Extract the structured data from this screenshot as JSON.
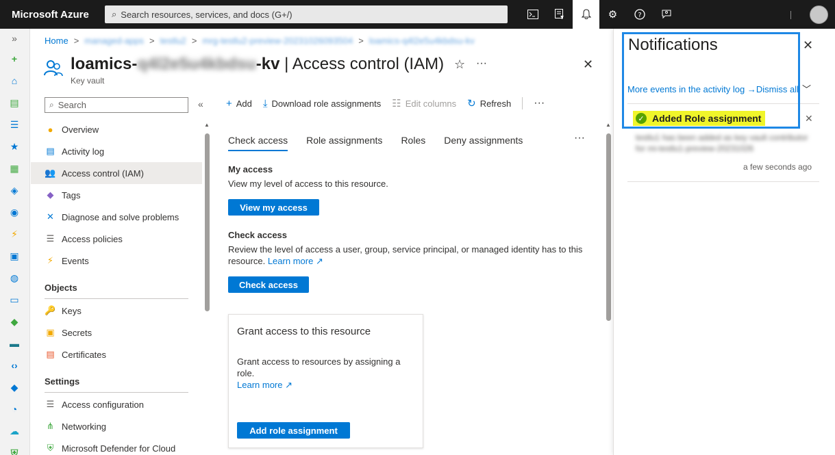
{
  "topbar": {
    "brand": "Microsoft Azure",
    "search_placeholder": "Search resources, services, and docs (G+/)",
    "icons": [
      "cloud-shell-icon",
      "directory-filter-icon",
      "bell-icon",
      "gear-icon",
      "help-icon",
      "feedback-icon"
    ]
  },
  "rail": {
    "expand_label": "»",
    "items": [
      {
        "name": "create-resource-icon",
        "glyph": "+",
        "color": "#3fa83f"
      },
      {
        "name": "home-icon",
        "glyph": "⌂",
        "color": "#0078d4"
      },
      {
        "name": "dashboard-icon",
        "glyph": "▤",
        "color": "#3fa83f"
      },
      {
        "name": "all-services-icon",
        "glyph": "☰",
        "color": "#0078d4"
      },
      {
        "name": "favorites-icon",
        "glyph": "★",
        "color": "#0078d4"
      },
      {
        "name": "all-resources-icon",
        "glyph": "▦",
        "color": "#3fa83f"
      },
      {
        "name": "resource-groups-icon",
        "glyph": "◈",
        "color": "#0078d4"
      },
      {
        "name": "app-services-icon",
        "glyph": "◉",
        "color": "#0078d4"
      },
      {
        "name": "function-app-icon",
        "glyph": "⚡",
        "color": "#f2a900"
      },
      {
        "name": "sql-database-icon",
        "glyph": "▣",
        "color": "#0078d4"
      },
      {
        "name": "cosmos-db-icon",
        "glyph": "◍",
        "color": "#0078d4"
      },
      {
        "name": "virtual-machines-icon",
        "glyph": "▭",
        "color": "#0078d4"
      },
      {
        "name": "load-balancers-icon",
        "glyph": "◆",
        "color": "#3fa83f"
      },
      {
        "name": "storage-accounts-icon",
        "glyph": "▬",
        "color": "#1c7a8c"
      },
      {
        "name": "virtual-networks-icon",
        "glyph": "‹›",
        "color": "#0078d4"
      },
      {
        "name": "entra-id-icon",
        "glyph": "◆",
        "color": "#0078d4"
      },
      {
        "name": "monitor-icon",
        "glyph": "◔",
        "color": "#0078d4"
      },
      {
        "name": "advisor-icon",
        "glyph": "☁",
        "color": "#1aa3c8"
      },
      {
        "name": "defender-icon",
        "glyph": "⛨",
        "color": "#3fa83f"
      }
    ]
  },
  "breadcrumb": {
    "home": "Home",
    "crumbs": [
      "managed-apps",
      "testlu2",
      "mrg-testlu2-preview-20231026093504",
      "loamics-q4l2e5u4kbdsu-kv"
    ],
    "separator": ">"
  },
  "resource": {
    "title_prefix": "loamics-",
    "title_blurred": "q4l2e5u4kbdsu",
    "title_suffix": "-kv",
    "title_page": " | Access control (IAM)",
    "subtitle": "Key vault",
    "favorite_glyph": "☆",
    "more_glyph": "···",
    "close_glyph": "✕"
  },
  "menu": {
    "search_placeholder": "Search",
    "collapse_glyph": "«",
    "items": [
      {
        "label": "Overview",
        "glyph": "●",
        "color": "#f2a900"
      },
      {
        "label": "Activity log",
        "glyph": "▤",
        "color": "#0078d4"
      },
      {
        "label": "Access control (IAM)",
        "glyph": "👥",
        "color": "#0078d4"
      },
      {
        "label": "Tags",
        "glyph": "◆",
        "color": "#8661c5"
      },
      {
        "label": "Diagnose and solve problems",
        "glyph": "✕",
        "color": "#0078d4"
      },
      {
        "label": "Access policies",
        "glyph": "☰",
        "color": "#605e5c"
      },
      {
        "label": "Events",
        "glyph": "⚡",
        "color": "#f2a900"
      }
    ],
    "objects_header": "Objects",
    "objects": [
      {
        "label": "Keys",
        "glyph": "🔑",
        "color": "#f2a900"
      },
      {
        "label": "Secrets",
        "glyph": "▣",
        "color": "#f2a900"
      },
      {
        "label": "Certificates",
        "glyph": "▤",
        "color": "#e8572c"
      }
    ],
    "settings_header": "Settings",
    "settings": [
      {
        "label": "Access configuration",
        "glyph": "☰",
        "color": "#605e5c"
      },
      {
        "label": "Networking",
        "glyph": "⋔",
        "color": "#3fa83f"
      },
      {
        "label": "Microsoft Defender for Cloud",
        "glyph": "⛨",
        "color": "#3fa83f"
      }
    ]
  },
  "commands": {
    "add": "Add",
    "download": "Download role assignments",
    "edit_columns": "Edit columns",
    "refresh": "Refresh",
    "more": "···"
  },
  "tabs": [
    "Check access",
    "Role assignments",
    "Roles",
    "Deny assignments"
  ],
  "tabs_more": "···",
  "my_access": {
    "title": "My access",
    "text": "View my level of access to this resource.",
    "button": "View my access"
  },
  "check_access": {
    "title": "Check access",
    "text": "Review the level of access a user, group, service principal, or managed identity has to this resource.",
    "link": "Learn more",
    "button": "Check access"
  },
  "grant": {
    "title": "Grant access to this resource",
    "text": "Grant access to resources by assigning a role.",
    "link": "Learn more",
    "button": "Add role assignment"
  },
  "notifications": {
    "title": "Notifications",
    "close_glyph": "✕",
    "more_events": "More events in the activity log →",
    "dismiss_all": "Dismiss all",
    "chevron_glyph": "﹀",
    "item": {
      "title": "Added Role assignment",
      "body": "testlu1 has been added as key vault contributor for mi-testlu1-preview-20231026",
      "time": "a few seconds ago"
    }
  }
}
